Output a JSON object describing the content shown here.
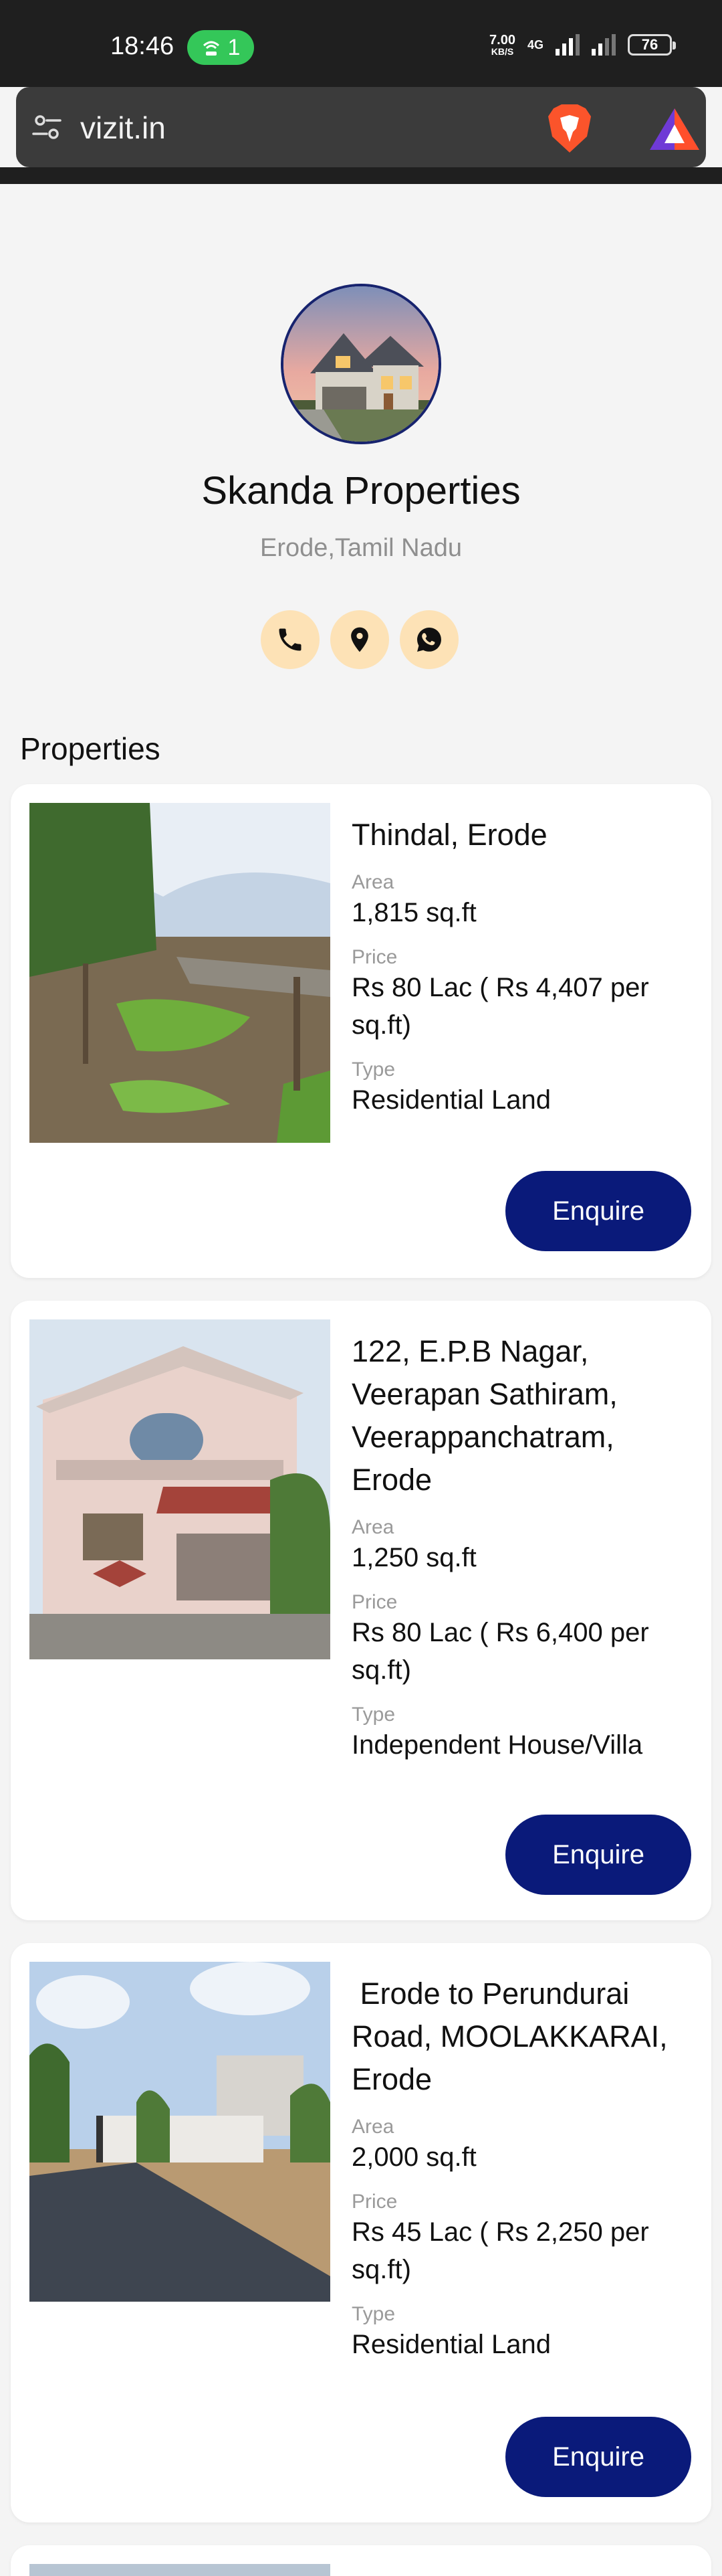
{
  "status_bar": {
    "time": "18:46",
    "hotspot_count": "1",
    "speed_value": "7.00",
    "speed_unit": "KB/S",
    "network": "4G",
    "battery": "76"
  },
  "browser": {
    "url": "vizit.in"
  },
  "profile": {
    "name": "Skanda Properties",
    "location": "Erode,Tamil Nadu"
  },
  "section_title": "Properties",
  "labels": {
    "area": "Area",
    "price": "Price",
    "type": "Type",
    "enquire": "Enquire"
  },
  "properties": [
    {
      "title": "Thindal, Erode",
      "area": "1,815 sq.ft",
      "price": "Rs 80 Lac ( Rs 4,407 per sq.ft)",
      "type": "Residential Land"
    },
    {
      "title": "122, E.P.B Nagar, Veerapan Sathiram, Veerappanchatram, Erode",
      "area": "1,250 sq.ft",
      "price": "Rs 80 Lac ( Rs 6,400 per sq.ft)",
      "type": "Independent House/Villa"
    },
    {
      "title": " Erode to Perundurai Road, MOOLAKKARAI, Erode",
      "area": "2,000 sq.ft",
      "price": "Rs 45 Lac ( Rs 2,250 per sq.ft)",
      "type": "Residential Land"
    }
  ],
  "colors": {
    "accent": "#0a1a7a",
    "contact_bg": "#fde2b6",
    "page_bg": "#f4f4f4"
  }
}
